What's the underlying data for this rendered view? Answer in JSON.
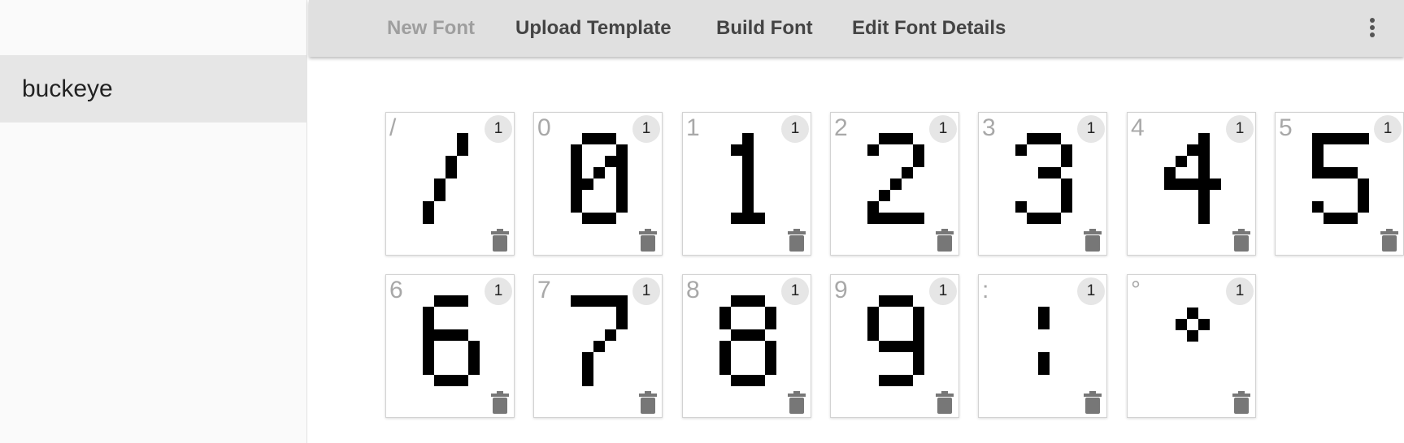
{
  "sidebar": {
    "items": [
      {
        "label": "buckeye"
      }
    ]
  },
  "toolbar": {
    "new_font": "New Font",
    "upload_template": "Upload Template",
    "build_font": "Build Font",
    "edit_font_details": "Edit Font Details",
    "more_icon": "more-vert-icon"
  },
  "glyphs": [
    {
      "char": "/",
      "count": "1"
    },
    {
      "char": "0",
      "count": "1"
    },
    {
      "char": "1",
      "count": "1"
    },
    {
      "char": "2",
      "count": "1"
    },
    {
      "char": "3",
      "count": "1"
    },
    {
      "char": "4",
      "count": "1"
    },
    {
      "char": "5",
      "count": "1"
    },
    {
      "char": "6",
      "count": "1"
    },
    {
      "char": "7",
      "count": "1"
    },
    {
      "char": "8",
      "count": "1"
    },
    {
      "char": "9",
      "count": "1"
    },
    {
      "char": ":",
      "count": "1"
    },
    {
      "char": "°",
      "count": "1"
    }
  ]
}
